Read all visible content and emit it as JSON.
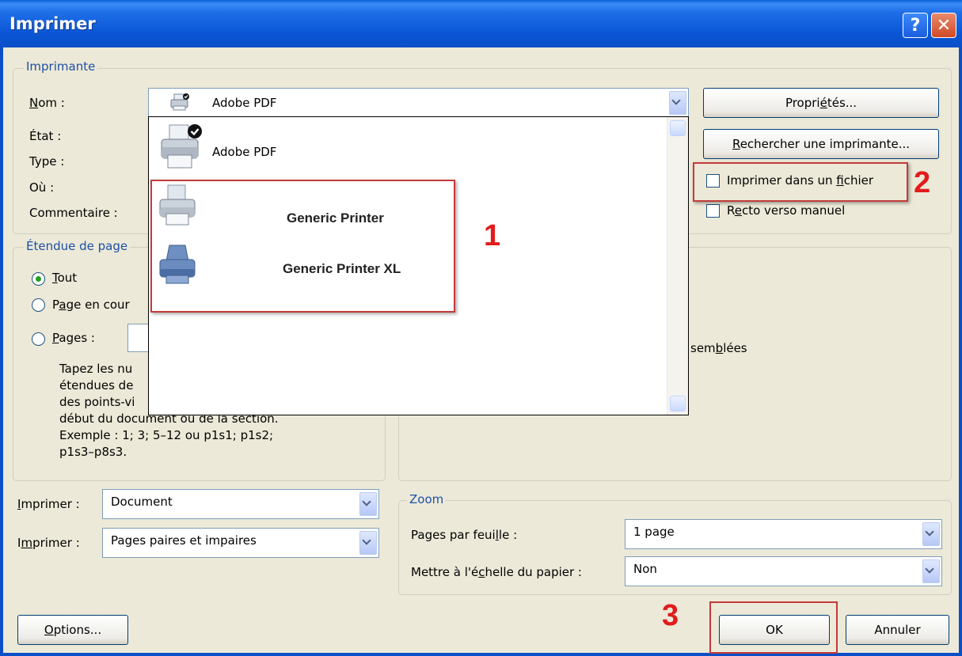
{
  "window": {
    "title": "Imprimer",
    "help_icon": "?",
    "close_icon": "✕"
  },
  "printer": {
    "group_label": "Imprimante",
    "name_label": "Nom :",
    "selected": "Adobe PDF",
    "status_label": "État :",
    "type_label": "Type :",
    "where_label": "Où :",
    "comment_label": "Commentaire :",
    "properties_button": "Propriétés...",
    "find_button": "Rechercher une imprimante...",
    "print_to_file_label": "Imprimer dans un fichier",
    "manual_duplex_label": "Recto verso manuel",
    "print_to_file_checked": false,
    "manual_duplex_checked": false
  },
  "dropdown": {
    "items": [
      {
        "label": "Adobe PDF",
        "icon": "printer-default-icon"
      },
      {
        "label": "Generic Printer",
        "icon": "printer-icon"
      },
      {
        "label": "Generic Printer XL",
        "icon": "printer-blue-icon"
      }
    ]
  },
  "page_range": {
    "group_label": "Étendue de page",
    "all_label": "Tout",
    "current_label": "Page en cour",
    "pages_label": "Pages :",
    "selected": "Tout",
    "help_lines": [
      "Tapez les nu",
      "étendues de",
      "des points-vi",
      "début du document ou de la section.",
      "Exemple : 1; 3; 5–12 ou p1s1; p1s2;",
      "p1s3–p8s3."
    ]
  },
  "copies": {
    "collate_fragment": "semblées"
  },
  "print_what": {
    "label": "Imprimer :",
    "value": "Document"
  },
  "print_pages": {
    "label": "Imprimer :",
    "value": "Pages paires et impaires"
  },
  "zoom": {
    "group_label": "Zoom",
    "pages_per_sheet_label": "Pages par feuille :",
    "pages_per_sheet_value": "1 page",
    "scale_label": "Mettre à l'échelle du papier :",
    "scale_value": "Non"
  },
  "buttons": {
    "options": "Options...",
    "ok": "OK",
    "cancel": "Annuler"
  },
  "annotations": {
    "one": "1",
    "two": "2",
    "three": "3",
    "color": "#e21b1b"
  }
}
